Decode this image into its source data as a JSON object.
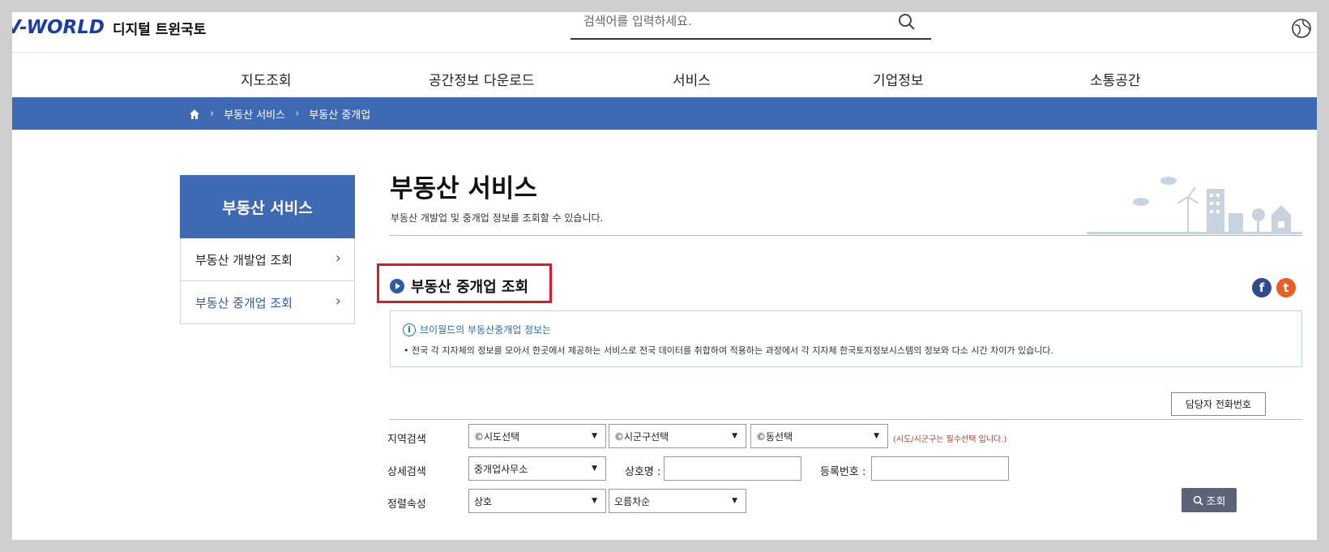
{
  "header": {
    "logo": "V-WORLD",
    "logo_sub": "디지털 트윈국토",
    "search_placeholder": "검색어를 입력하세요."
  },
  "nav": [
    "지도조회",
    "공간정보 다운로드",
    "서비스",
    "기업정보",
    "소통공간"
  ],
  "breadcrumb": [
    "부동산 서비스",
    "부동산 중개업"
  ],
  "sidebar": {
    "title": "부동산 서비스",
    "items": [
      {
        "label": "부동산 개발업 조회",
        "active": false
      },
      {
        "label": "부동산 중개업 조회",
        "active": true
      }
    ]
  },
  "content": {
    "title": "부동산 서비스",
    "desc": "부동산 개발업 및 중개업 정보를 조회할 수 있습니다.",
    "section_title": "부동산 중개업 조회",
    "info_head": "브이월드의 부동산중개업 정보는",
    "info_body": "• 전국 각 지자체의 정보를 모아서 한곳에서 제공하는 서비스로 전국 데이터를 취합하여 적용하는 과정에서 각 지자체 한국토지정보시스템의 정보와 다소 시간 차이가 있습니다.",
    "tel_button": "담당자 전화번호"
  },
  "form": {
    "region_label": "지역검색",
    "sido": "©시도선택",
    "sigungu": "©시군구선택",
    "dong": "©동선택",
    "required_note": "(시도/시군구는 필수선택 입니다.)",
    "detail_label": "상세검색",
    "detail_value": "중개업사무소",
    "name_label": "상호명 :",
    "reg_label": "등록번호 :",
    "sort_label": "정렬속성",
    "sort_field": "상호",
    "sort_order": "오름차순",
    "search_button": "조회"
  },
  "social": [
    "f",
    "t"
  ]
}
